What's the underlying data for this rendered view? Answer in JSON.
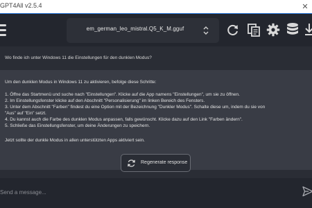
{
  "window": {
    "title": "GPT4All v2.5.4",
    "close_glyph": "✕"
  },
  "toolbar": {
    "model_name": "em_german_leo_mistral.Q5_K_M.gguf",
    "icons": [
      "hamburger-icon",
      "refresh-icon",
      "copy-icon",
      "gear-icon",
      "database-icon",
      "download-icon"
    ]
  },
  "chat": {
    "user_message": "Wo finde ich unter Windows 11 die Einstellungen für den dunklen Modus?",
    "assistant_lines": [
      "Um den dunklen Modus in Windows 11 zu aktivieren, befolge diese Schritte:",
      "1. Öffne das Startmenü und suche nach \"Einstellungen\". Klicke auf die App namens \"Einstellungen\", um sie zu öffnen.",
      "2. Im Einstellungsfenster klicke auf den Abschnitt \"Personalisierung\" im linken Bereich des Fensters.",
      "3. Unter dem Abschnitt \"Farben\" findest du eine Option mit der Bezeichnung \"Dunkler Modus\". Schalte diese um, indem du sie von",
      "\"Aus\" auf \"Ein\" setzt.",
      "4. Du kannst auch die Farbe des dunklen Modus anpassen, falls gewünscht. Klicke dazu auf den Link \"Farben ändern\".",
      "5. Schließe das Einstellungsfenster, um deine Änderungen zu speichern.",
      "Jetzt sollte der dunkle Modus in allen unterstützten Apps aktiviert sein."
    ],
    "regenerate_label": "Regenerate response"
  },
  "input": {
    "placeholder": "Send a message..."
  },
  "colors": {
    "accent": "#1f6fd6",
    "background": "#2a2d35",
    "assistant_bg": "#393c45",
    "toolbar_bg": "#23262e"
  }
}
